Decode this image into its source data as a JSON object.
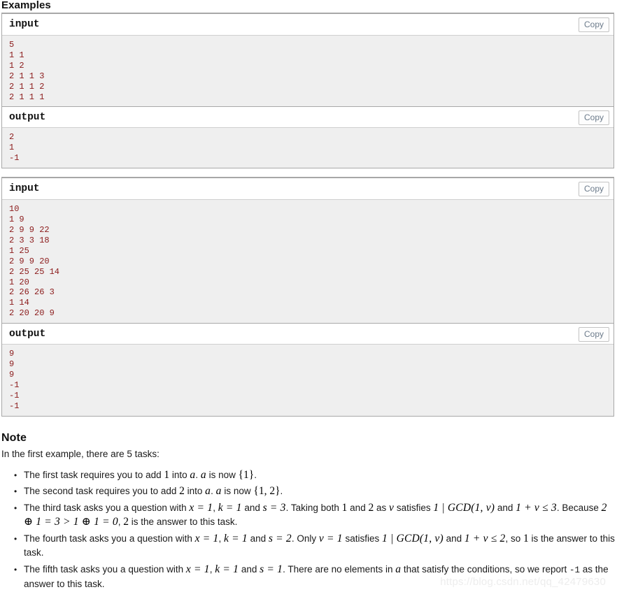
{
  "examples": {
    "heading": "Examples",
    "blocks": [
      {
        "input": {
          "label": "input",
          "copy_label": "Copy",
          "text": "5\n1 1\n1 2\n2 1 1 3\n2 1 1 2\n2 1 1 1"
        },
        "output": {
          "label": "output",
          "copy_label": "Copy",
          "text": "2\n1\n-1"
        }
      },
      {
        "input": {
          "label": "input",
          "copy_label": "Copy",
          "text": "10\n1 9\n2 9 9 22\n2 3 3 18\n1 25\n2 9 9 20\n2 25 25 14\n1 20\n2 26 26 3\n1 14\n2 20 20 9"
        },
        "output": {
          "label": "output",
          "copy_label": "Copy",
          "text": "9\n9\n9\n-1\n-1\n-1"
        }
      }
    ]
  },
  "note": {
    "heading": "Note",
    "intro": "In the first example, there are 5 tasks:",
    "bullets": {
      "b1": {
        "t1": "The first task requires you to add ",
        "m1": "1",
        "t2": " into ",
        "m2": "a",
        "t3": ". ",
        "m3": "a",
        "t4": " is now ",
        "m4": "{1}",
        "t5": "."
      },
      "b2": {
        "t1": "The second task requires you to add ",
        "m1": "2",
        "t2": " into ",
        "m2": "a",
        "t3": ". ",
        "m3": "a",
        "t4": " is now ",
        "m4": "{1, 2}",
        "t5": "."
      },
      "b3": {
        "t1": "The third task asks you a question with ",
        "m1": "x = 1",
        "t2": ", ",
        "m2": "k = 1",
        "t3": " and ",
        "m3": "s = 3",
        "t4": ". Taking both ",
        "m4": "1",
        "t5": " and ",
        "m5": "2",
        "t6": " as ",
        "m6": "v",
        "t7": " satisfies ",
        "m7": "1 | GCD(1, v)",
        "t8": " and ",
        "m8": "1 + v ≤ 3",
        "t9": ". Because ",
        "m9": "2 ⊕ 1 = 3 > 1 ⊕ 1 = 0",
        "t10": ", ",
        "m10": "2",
        "t11": " is the answer to this task."
      },
      "b4": {
        "t1": "The fourth task asks you a question with ",
        "m1": "x = 1",
        "t2": ", ",
        "m2": "k = 1",
        "t3": " and ",
        "m3": "s = 2",
        "t4": ". Only ",
        "m4": "v = 1",
        "t5": " satisfies ",
        "m5": "1 | GCD(1, v)",
        "t6": " and ",
        "m6": "1 + v ≤ 2",
        "t7": ", so ",
        "m7": "1",
        "t8": " is the answer to this task."
      },
      "b5": {
        "t1": "The fifth task asks you a question with ",
        "m1": "x = 1",
        "t2": ", ",
        "m2": "k = 1",
        "t3": " and ",
        "m3": "s = 1",
        "t4": ". There are no elements in ",
        "m4": "a",
        "t5": " that satisfy the conditions, so we report ",
        "code1": "-1",
        "t6": " as the answer to this task."
      }
    }
  },
  "watermark": "https://blog.csdn.net/qq_42479630"
}
